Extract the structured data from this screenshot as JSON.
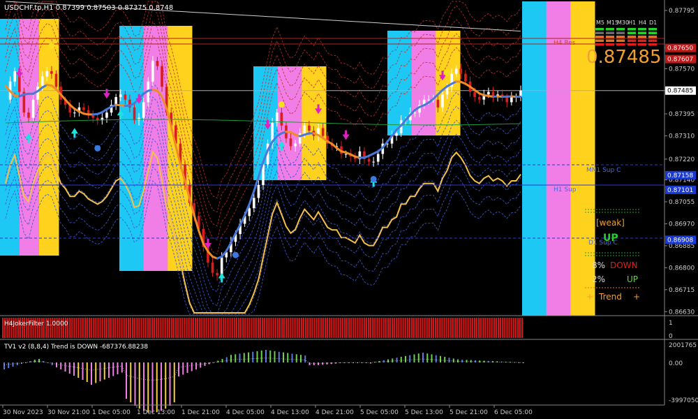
{
  "window": {
    "symbol_line": "USDCHF.tp,H1  0.87399 0.87503 0.87375 0.8748",
    "bid_big": "0.87485"
  },
  "colors": {
    "background": "#000000",
    "candle_bull": "#ffffff",
    "candle_bear": "#d81e1e",
    "zone_cyan": "#1ec8f5",
    "zone_pink": "#f07ee6",
    "zone_yellow": "#ffd21e",
    "ma_up": "#4a78d8",
    "ma_down": "#f08c28",
    "ma_slow": "#1e9a3c",
    "band_outer": "#f5c04a",
    "band_red": "#c0302a",
    "band_blue": "#3a5ad0",
    "price_line": "#cfcfcf",
    "hist_bar": "#d01818",
    "osc_blue": "#5a7ae0",
    "osc_green": "#6ad04a",
    "osc_yellow": "#f5d040",
    "osc_pink": "#f07ee6",
    "up_text": "#6ad04a",
    "down_text": "#e01e1e",
    "orange_text": "#f0a032"
  },
  "right_axis": {
    "ticks": [
      "0.87795",
      "0.87650",
      "0.87570",
      "0.87485",
      "0.87395",
      "0.87310",
      "0.87220",
      "0.87140",
      "0.87055",
      "0.86970",
      "0.86885",
      "0.86800",
      "0.86715",
      "0.86630"
    ],
    "tags": [
      "0.87650",
      "0.87607",
      "0.87485",
      "0.87158",
      "0.87101",
      "0.86908"
    ]
  },
  "levels": {
    "h4_res": "H4 Res",
    "mn1_sup": "MN1 Sup C",
    "h1_sup": "H1 Sup",
    "d1_sup": "D1 Sup C"
  },
  "timeframe_labels": [
    "M5",
    "M15",
    "M30",
    "H1",
    "H4",
    "D1"
  ],
  "panel_info": {
    "weak": "[weak]",
    "up_word": "UP",
    "down_pct": "8%",
    "down_word": "DOWN",
    "up_pct": "2%",
    "up_word2": "UP",
    "trend_plus_left": "+",
    "trend": "Trend",
    "trend_plus_right": "+"
  },
  "filter_panel": {
    "label": "H4JokerFilter 1.0000",
    "axis_ticks": [
      "1",
      "0"
    ]
  },
  "osc_panel": {
    "label": "TV1 v2 (8,8,4) Trend is DOWN -687376.88238",
    "axis_ticks": [
      "2001765",
      "0.00",
      "-3997050"
    ]
  },
  "time_axis": [
    "30 Nov 2023",
    "30 Nov 21:00",
    "1 Dec 05:00",
    "1 Dec 13:00",
    "1 Dec 21:00",
    "4 Dec 05:00",
    "4 Dec 13:00",
    "4 Dec 21:00",
    "5 Dec 05:00",
    "5 Dec 13:00",
    "5 Dec 21:00",
    "6 Dec 05:00"
  ],
  "chart_data": {
    "type": "candlestick",
    "title": "USDCHF.tp,H1",
    "ohlc_header": {
      "open": 0.87399,
      "high": 0.87503,
      "low": 0.87375,
      "close": 0.8748
    },
    "ylim": [
      0.8662,
      0.8783
    ],
    "close_series": [
      0.8745,
      0.8752,
      0.8756,
      0.8748,
      0.874,
      0.8738,
      0.8745,
      0.875,
      0.8754,
      0.8756,
      0.8755,
      0.875,
      0.8745,
      0.8743,
      0.874,
      0.874,
      0.8742,
      0.8741,
      0.8739,
      0.8738,
      0.8737,
      0.8738,
      0.874,
      0.8743,
      0.8746,
      0.8747,
      0.8745,
      0.8742,
      0.8737,
      0.8738,
      0.8744,
      0.8752,
      0.876,
      0.8758,
      0.875,
      0.874,
      0.8735,
      0.8728,
      0.872,
      0.8712,
      0.8705,
      0.87,
      0.8695,
      0.8688,
      0.8682,
      0.8678,
      0.8677,
      0.8684,
      0.8686,
      0.869,
      0.8693,
      0.8697,
      0.87,
      0.8703,
      0.8707,
      0.8712,
      0.872,
      0.8728,
      0.8736,
      0.874,
      0.8735,
      0.873,
      0.8727,
      0.8728,
      0.8732,
      0.8735,
      0.8733,
      0.8731,
      0.8734,
      0.8731,
      0.8728,
      0.8727,
      0.8727,
      0.8724,
      0.8724,
      0.8723,
      0.8722,
      0.8725,
      0.8722,
      0.8721,
      0.8721,
      0.8724,
      0.8728,
      0.8728,
      0.8731,
      0.8732,
      0.8737,
      0.8737,
      0.874,
      0.874,
      0.8743,
      0.8745,
      0.8745,
      0.8745,
      0.8742,
      0.8747,
      0.875,
      0.8755,
      0.8757,
      0.8755,
      0.8752,
      0.8748,
      0.8746,
      0.8745,
      0.8747,
      0.8748,
      0.8746,
      0.8747,
      0.8746,
      0.8744,
      0.8746,
      0.8746,
      0.87485
    ],
    "indicators": [
      "H4JokerFilter 1.0000",
      "TV1 v2 (8,8,4) Trend is DOWN"
    ]
  }
}
